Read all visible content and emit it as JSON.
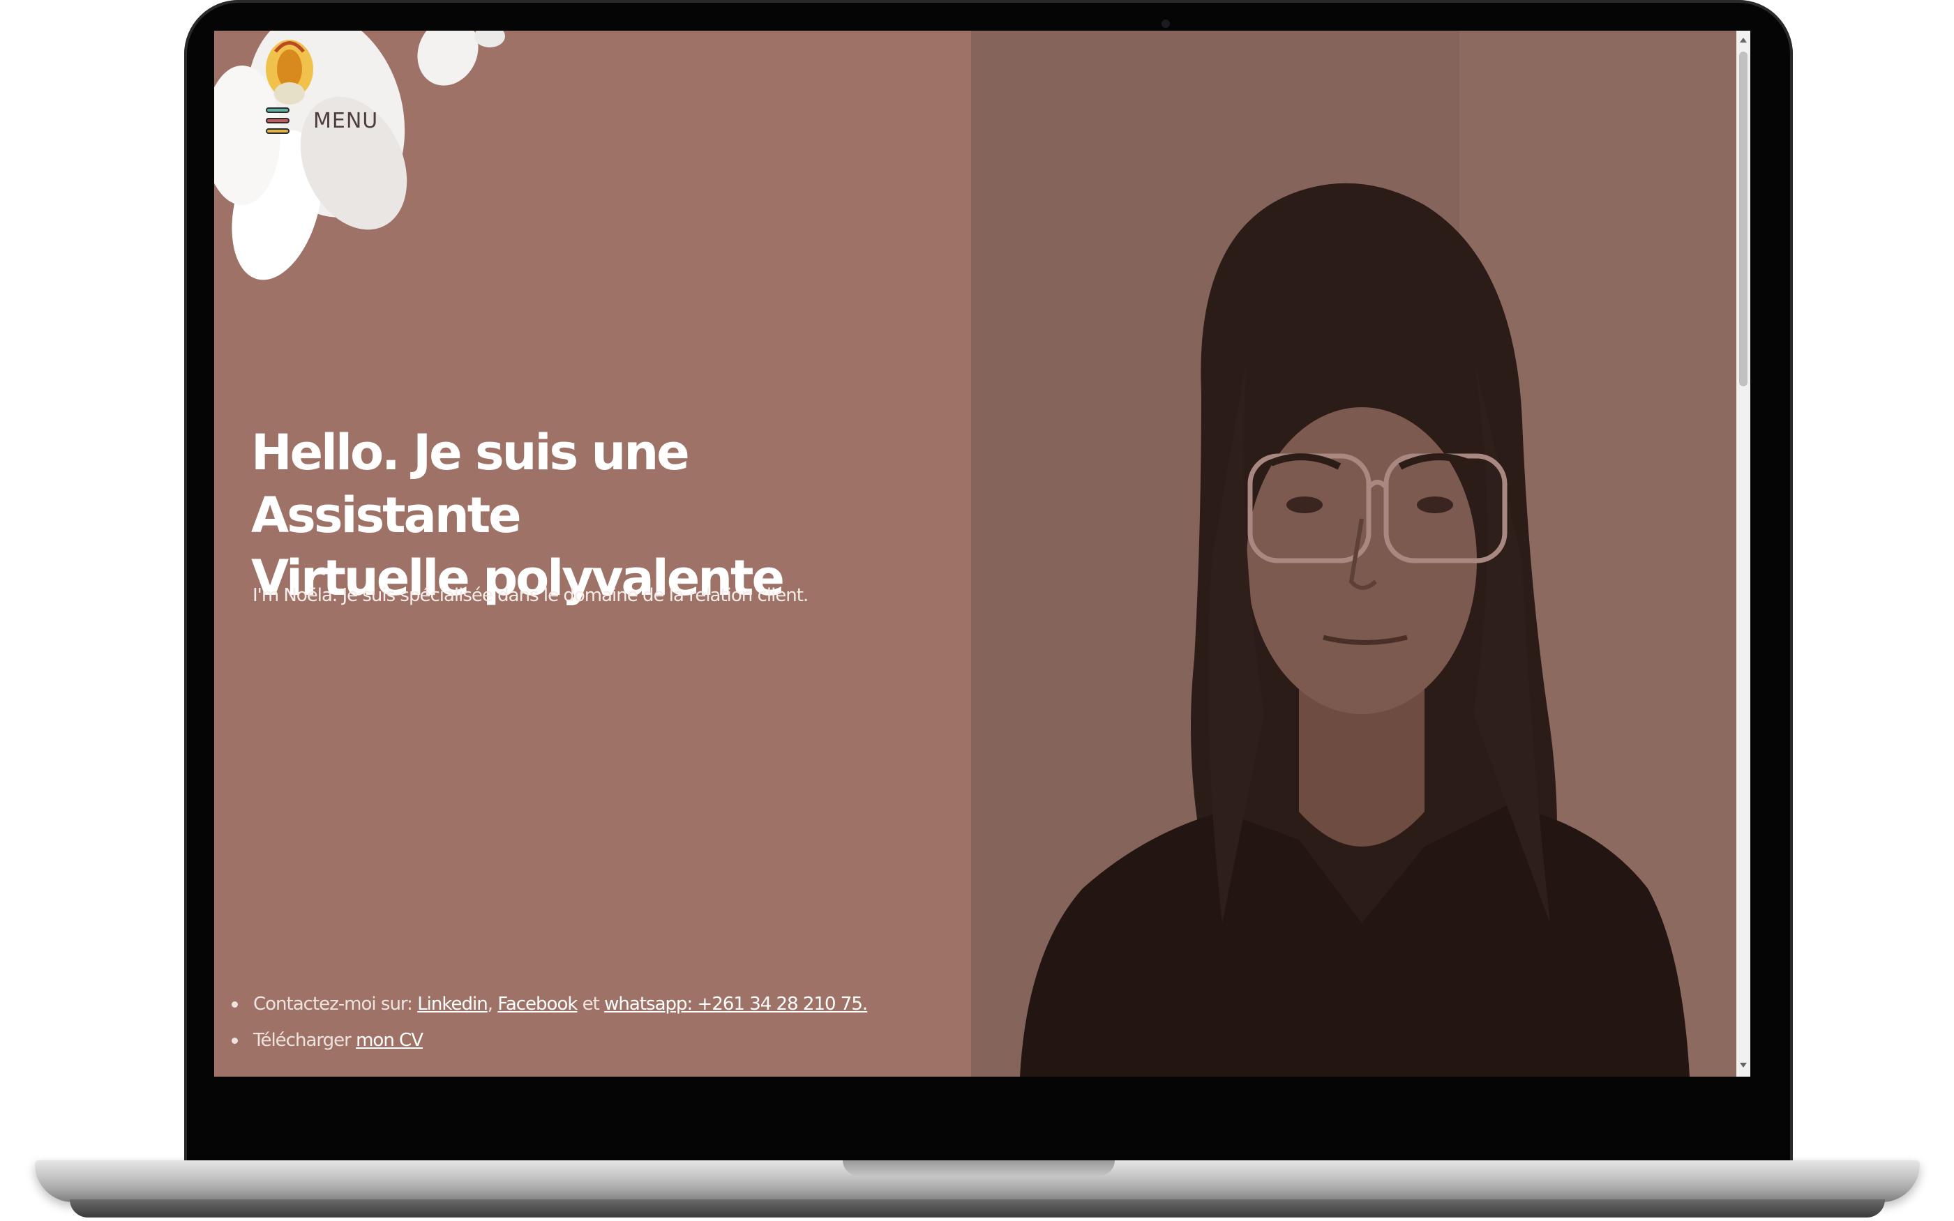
{
  "menu": {
    "label": "MENU",
    "icon": "hamburger-icon"
  },
  "hero": {
    "title_line1": "Hello. Je suis une Assistante",
    "title_line2": "Virtuelle polyvalente",
    "subtitle": "I'm Noëla. Je suis spécialisée dans le domaine de la relation client."
  },
  "contact": {
    "prefix": "Contactez-moi sur: ",
    "linkedin": "Linkedin",
    "sep1": ", ",
    "facebook": "Facebook",
    "sep2": " et ",
    "whatsapp": "whatsapp: +261 34 28 210 75.",
    "download_prefix": "Télécharger ",
    "cv_link": "mon CV"
  },
  "colors": {
    "left_panel": "#9e7266",
    "right_panel": "#84635a",
    "text": "#ffffff",
    "menu_text": "#4d3e3b"
  }
}
